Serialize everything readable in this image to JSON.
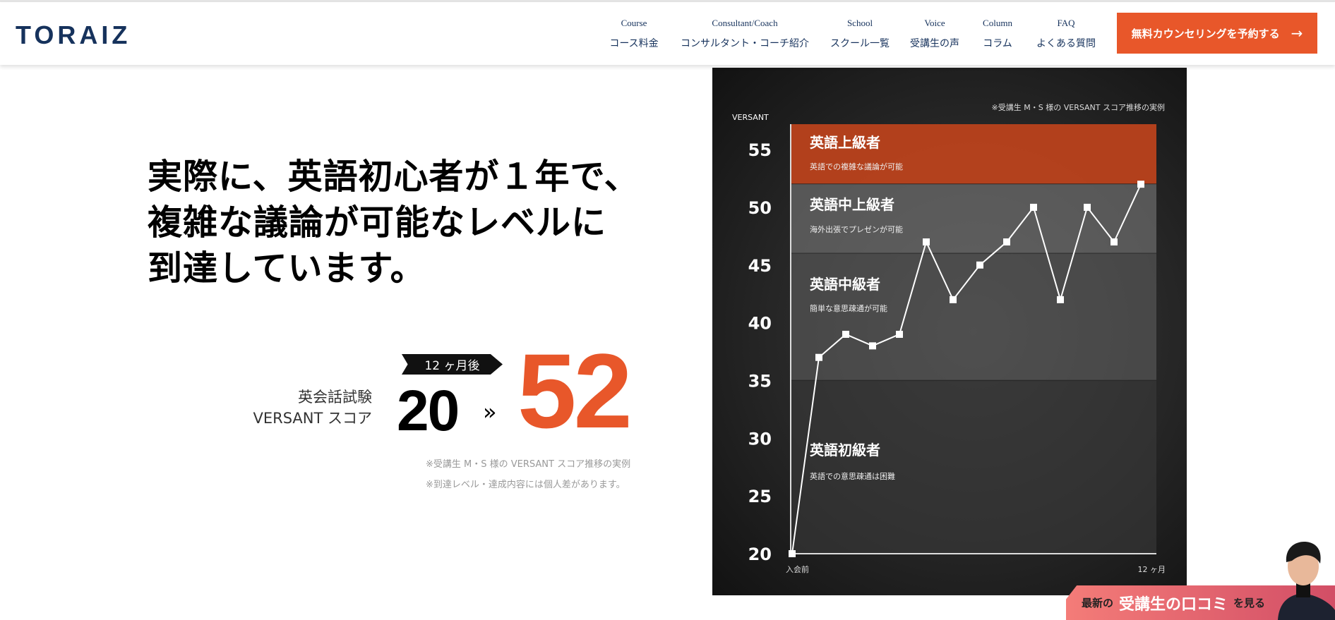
{
  "header": {
    "logo": "TORAIZ",
    "nav": [
      {
        "en": "Course",
        "ja": "コース料金"
      },
      {
        "en": "Consultant/Coach",
        "ja": "コンサルタント・コーチ紹介"
      },
      {
        "en": "School",
        "ja": "スクール一覧"
      },
      {
        "en": "Voice",
        "ja": "受講生の声"
      },
      {
        "en": "Column",
        "ja": "コラム"
      },
      {
        "en": "FAQ",
        "ja": "よくある質問"
      }
    ],
    "cta": "無料カウンセリングを予約する",
    "cta_icon": "arrow-right-icon"
  },
  "hero": {
    "headline": [
      "実際に、英語初心者が１年で、",
      "複雑な議論が可能なレベルに",
      "到達しています。"
    ],
    "badge": "12 ヶ月後",
    "exam_line1": "英会話試験",
    "exam_line2": "VERSANT スコア",
    "from": "20",
    "arrow": "»",
    "to": "52",
    "notes": [
      "※受講生 M・S 様の VERSANT スコア推移の実例",
      "※到達レベル・達成内容には個人差があります。"
    ]
  },
  "accent": "#e8572a",
  "chart_data": {
    "type": "line",
    "caption": "※受講生 M・S 様の VERSANT スコア推移の実例",
    "ylabel": "VERSANT",
    "yticks": [
      20,
      25,
      30,
      35,
      40,
      45,
      50,
      55
    ],
    "ylim": [
      20,
      57.2
    ],
    "xlabels": {
      "start": "入会前",
      "end": "12 ヶ月"
    },
    "values": [
      20,
      37,
      39,
      38,
      39,
      47,
      42,
      45,
      47,
      50,
      42,
      50,
      47,
      52
    ],
    "bands": [
      {
        "from": 52,
        "to": 57.2,
        "title": "英語上級者",
        "desc": "英語での複雑な議論が可能",
        "color": "#c2441c"
      },
      {
        "from": 46,
        "to": 52,
        "title": "英語中上級者",
        "desc": "海外出張でプレゼンが可能",
        "color": "#7a7a7a"
      },
      {
        "from": 35,
        "to": 46,
        "title": "英語中級者",
        "desc": "簡単な意思疎通が可能",
        "color": "#5e5e5e"
      },
      {
        "from": 20,
        "to": 35,
        "title": "英語初級者",
        "desc": "英語での意思疎通は困難",
        "color": "#3a3a3a"
      }
    ]
  },
  "review": {
    "pre": "最新の",
    "main": "受講生の口コミ",
    "post": "を見る"
  }
}
